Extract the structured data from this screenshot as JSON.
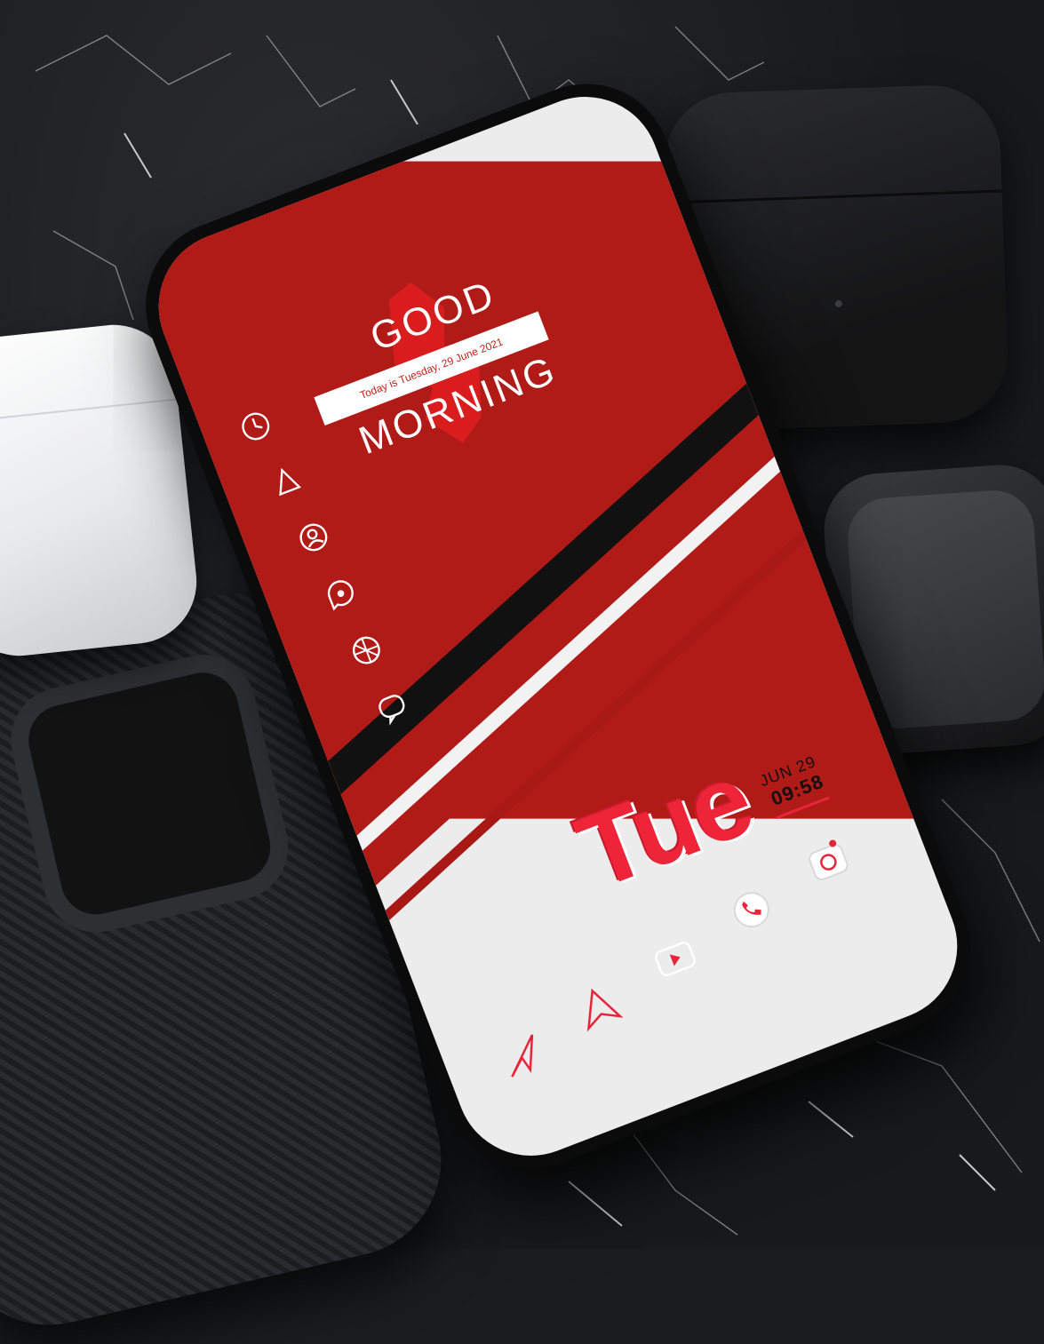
{
  "home_screen": {
    "greeting_line1": "GOOD",
    "greeting_line2": "MORNING",
    "date_sentence": "Today is Tuesday, 29 June 2021",
    "weekday_short": "Tue",
    "date_short": "JUN 29",
    "time": "09:58"
  },
  "side_icons": [
    "clock-icon",
    "triangle-icon",
    "contacts-icon",
    "messages-icon",
    "gallery-icon",
    "chat-icon"
  ],
  "dock_icons": [
    "send-icon",
    "maps-icon",
    "youtube-icon",
    "phone-icon",
    "camera-icon"
  ],
  "colors": {
    "accent_red": "#b01a17",
    "bright_red": "#ee2438",
    "white": "#ffffff",
    "stripe_black": "#111111"
  }
}
